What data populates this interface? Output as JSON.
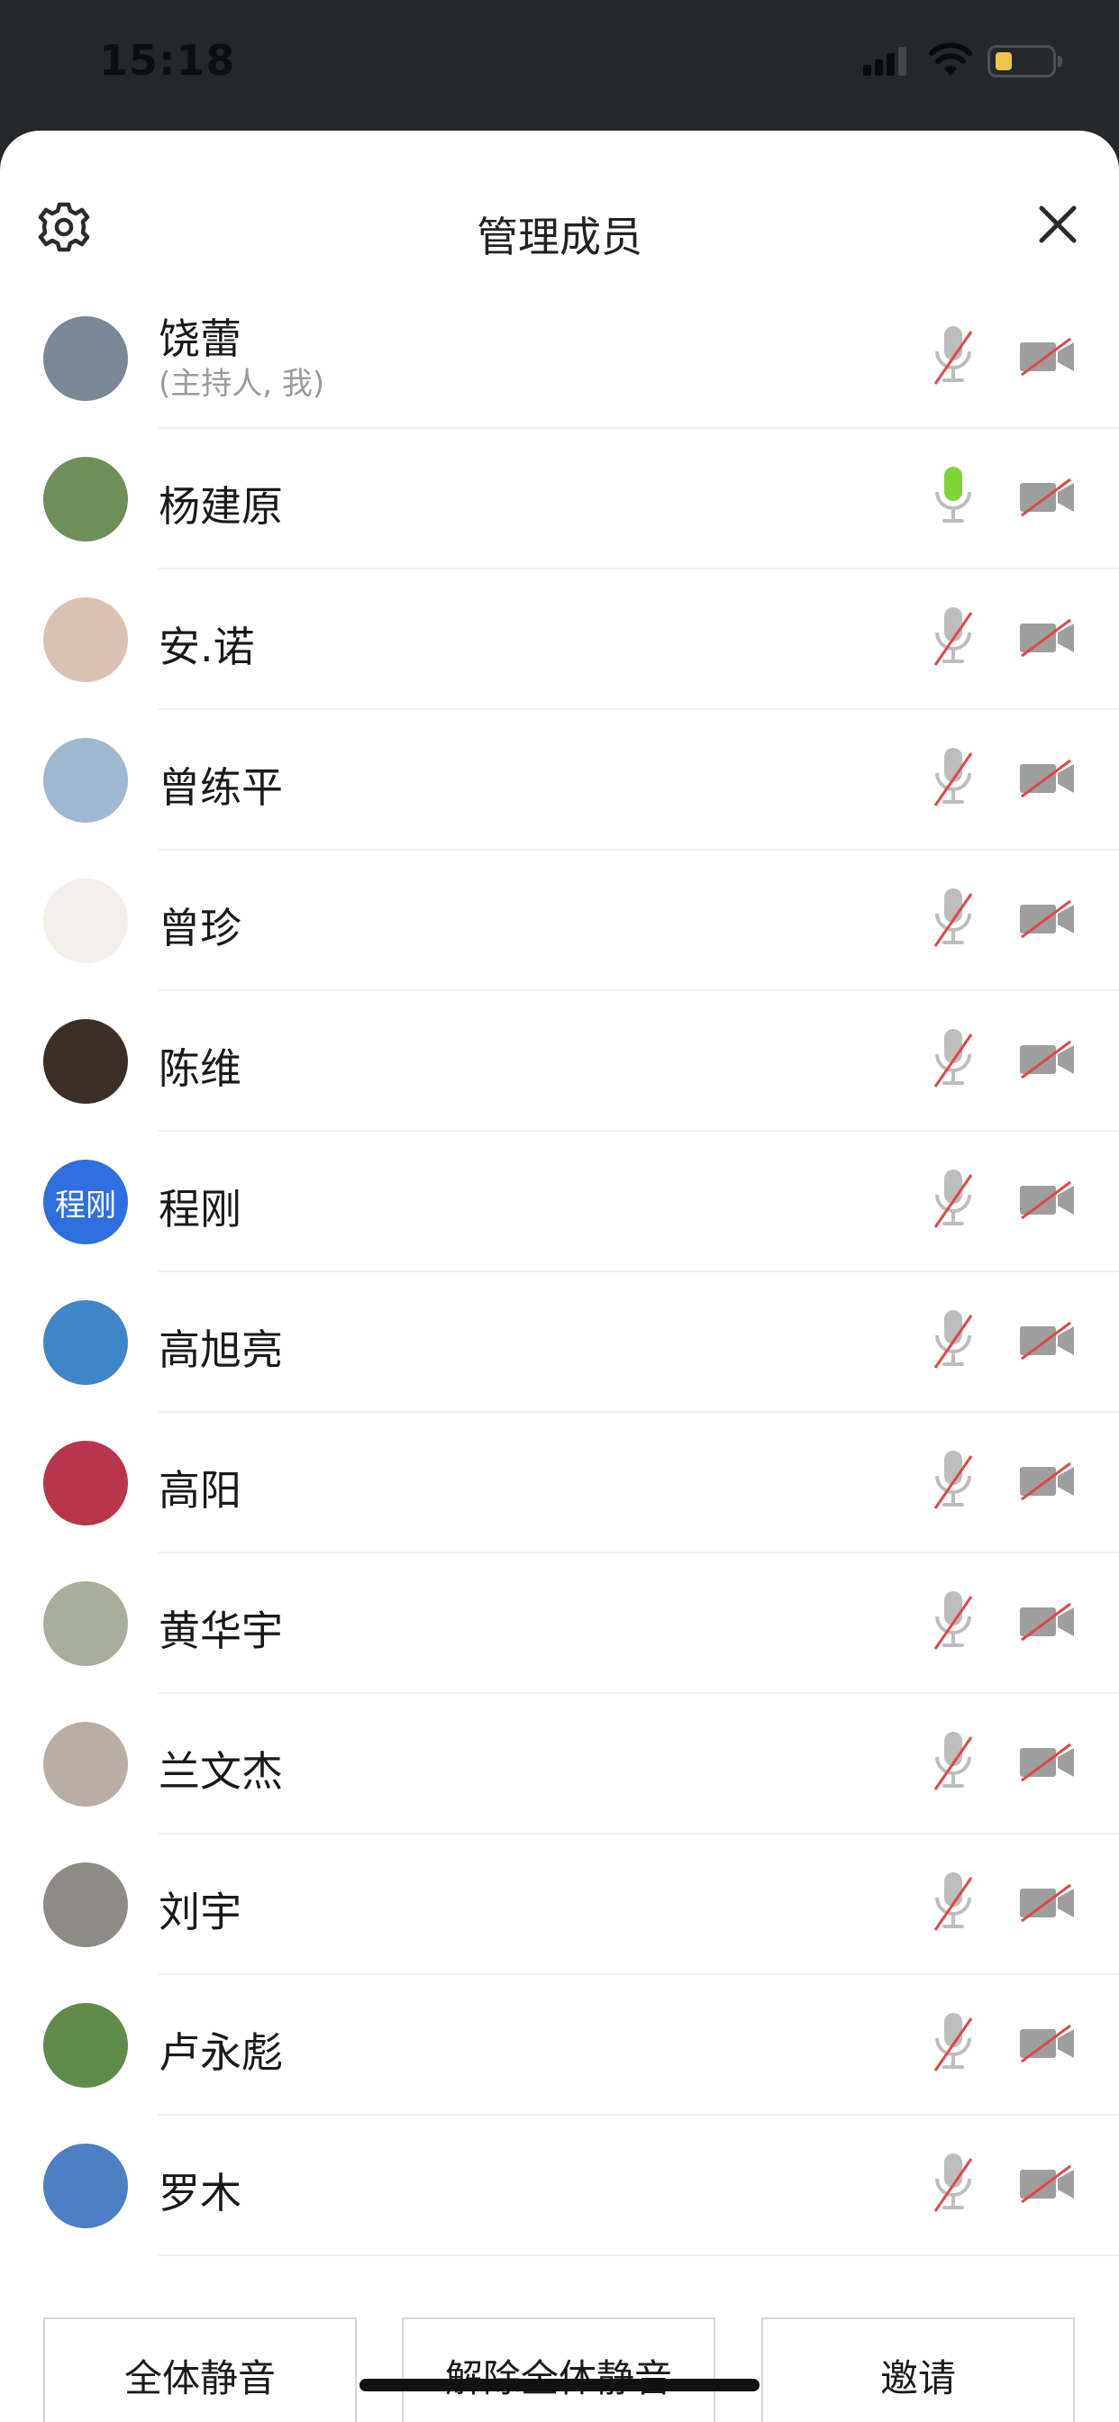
{
  "status_bar": {
    "time": "15:18"
  },
  "header": {
    "title": "管理成员"
  },
  "members": [
    {
      "name": "饶蕾",
      "subtitle": "(主持人, 我)",
      "mic": "muted",
      "camera": "off",
      "avatar_color": "#7a8795"
    },
    {
      "name": "杨建原",
      "mic": "active",
      "camera": "off",
      "avatar_color": "#6f8f5a"
    },
    {
      "name": "安.诺",
      "mic": "muted",
      "camera": "off",
      "avatar_color": "#d9c2b4"
    },
    {
      "name": "曾练平",
      "mic": "muted",
      "camera": "off",
      "avatar_color": "#9fb7cf"
    },
    {
      "name": "曾珍",
      "mic": "muted",
      "camera": "off",
      "avatar_color": "#f3efe9"
    },
    {
      "name": "陈维",
      "mic": "muted",
      "camera": "off",
      "avatar_color": "#3a2e27"
    },
    {
      "name": "程刚",
      "mic": "muted",
      "camera": "off",
      "avatar_color": "#2f6fe0",
      "avatar_text": "程刚"
    },
    {
      "name": "高旭亮",
      "mic": "muted",
      "camera": "off",
      "avatar_color": "#3f86c8"
    },
    {
      "name": "高阳",
      "mic": "muted",
      "camera": "off",
      "avatar_color": "#b8364a"
    },
    {
      "name": "黄华宇",
      "mic": "muted",
      "camera": "off",
      "avatar_color": "#a9ad9b"
    },
    {
      "name": "兰文杰",
      "mic": "muted",
      "camera": "off",
      "avatar_color": "#b9aea4"
    },
    {
      "name": "刘宇",
      "mic": "muted",
      "camera": "off",
      "avatar_color": "#8e8a86"
    },
    {
      "name": "卢永彪",
      "mic": "muted",
      "camera": "off",
      "avatar_color": "#5f8c48"
    },
    {
      "name": "罗木",
      "mic": "muted",
      "camera": "off",
      "avatar_color": "#4c7fc3"
    }
  ],
  "actions": {
    "mute_all": "全体静音",
    "unmute_all": "解除全体静音",
    "invite": "邀请"
  }
}
